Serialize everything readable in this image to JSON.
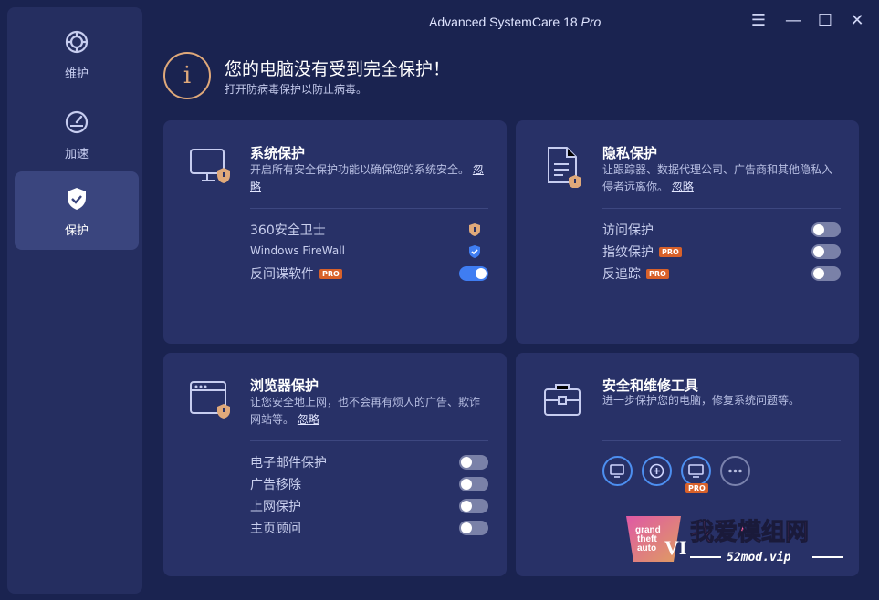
{
  "window": {
    "title_main": "Advanced SystemCare 18",
    "title_edition": "Pro"
  },
  "window_controls": {
    "menu": "☰",
    "minimize": "—",
    "maximize": "☐",
    "close": "✕"
  },
  "sidebar": {
    "items": [
      {
        "label": "维护",
        "icon": "gear-icon",
        "active": false
      },
      {
        "label": "加速",
        "icon": "speedometer-icon",
        "active": false
      },
      {
        "label": "保护",
        "icon": "shield-check-icon",
        "active": true
      }
    ]
  },
  "alert": {
    "title": "您的电脑没有受到完全保护！",
    "subtitle": "打开防病毒保护以防止病毒。",
    "icon": "info-icon",
    "color": "#e0a97a"
  },
  "cards": {
    "system": {
      "title": "系统保护",
      "desc": "开启所有安全保护功能以确保您的系统安全。",
      "ignore": "忽略",
      "rows": [
        {
          "label": "360安全卫士",
          "status": "warning"
        },
        {
          "label": "Windows FireWall",
          "status": "protected"
        },
        {
          "label": "反间谍软件",
          "pro": "PRO",
          "toggle": true
        }
      ]
    },
    "privacy": {
      "title": "隐私保护",
      "desc": "让跟踪器、数据代理公司、广告商和其他隐私入侵者远离你。",
      "ignore": "忽略",
      "rows": [
        {
          "label": "访问保护",
          "toggle": false
        },
        {
          "label": "指纹保护",
          "pro": "PRO",
          "toggle": false
        },
        {
          "label": "反追踪",
          "pro": "PRO",
          "toggle": false
        }
      ]
    },
    "browser": {
      "title": "浏览器保护",
      "desc": "让您安全地上网，也不会再有烦人的广告、欺诈网站等。",
      "ignore": "忽略",
      "rows": [
        {
          "label": "电子邮件保护",
          "toggle": false
        },
        {
          "label": "广告移除",
          "toggle": false
        },
        {
          "label": "上网保护",
          "toggle": false
        },
        {
          "label": "主页顾问",
          "toggle": false
        }
      ]
    },
    "tools": {
      "title": "安全和维修工具",
      "desc": "进一步保护您的电脑，修复系统问题等。",
      "tools": [
        {
          "icon": "monitor-shield-icon"
        },
        {
          "icon": "refresh-plus-icon"
        },
        {
          "icon": "monitor-pro-icon",
          "pro": "PRO"
        },
        {
          "icon": "more-icon"
        }
      ]
    }
  },
  "watermark": {
    "brand": "我爱模组网",
    "url": "52mod.vip",
    "logo_text": "grand theft auto VI"
  },
  "colors": {
    "accent": "#3f7df2",
    "warning": "#e0a97a",
    "pro": "#d8612a",
    "background": "#1a2350",
    "card": "#283167"
  }
}
